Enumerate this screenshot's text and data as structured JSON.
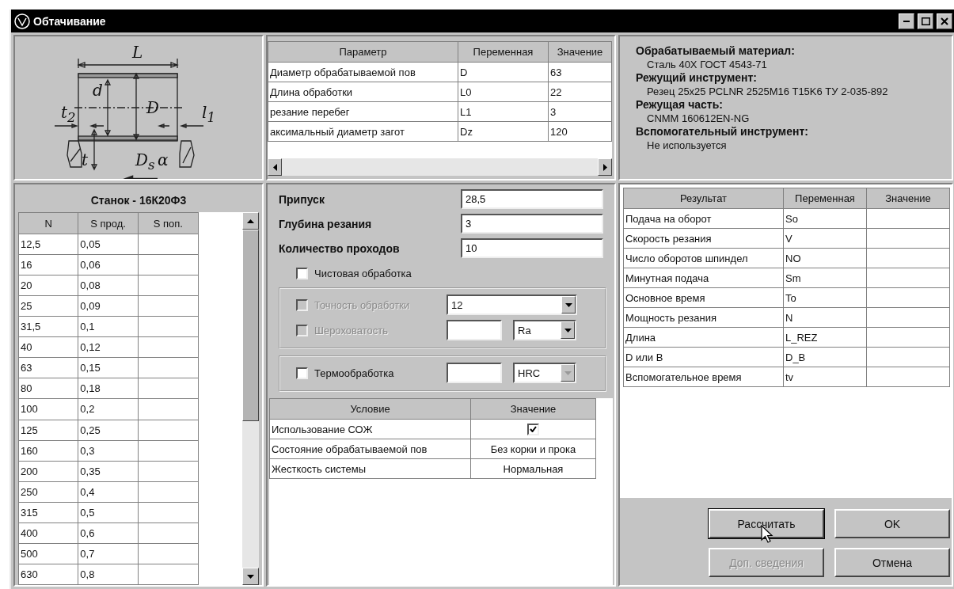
{
  "window": {
    "title": "Обтачивание"
  },
  "sketch": {
    "labels": [
      "L",
      "d",
      "D",
      "t$_{2}$",
      "l$_{1}$",
      "t",
      "D$_{s}$",
      "α"
    ]
  },
  "params_table": {
    "columns": [
      "Параметр",
      "Переменная",
      "Значение"
    ],
    "rows": [
      [
        "Диаметр обрабатываемой пов",
        "D",
        "63"
      ],
      [
        "Длина обработки",
        "L0",
        "22"
      ],
      [
        "резание перебег",
        "L1",
        "3"
      ],
      [
        "аксимальный диаметр загот",
        "Dz",
        "120"
      ]
    ]
  },
  "info": [
    {
      "kind": "heading",
      "text": "Обрабатываемый материал:"
    },
    {
      "kind": "value",
      "text": "Сталь 40Х ГОСТ 4543-71"
    },
    {
      "kind": "heading",
      "text": "Режущий инструмент:"
    },
    {
      "kind": "value",
      "text": "Резец 25x25 PCLNR 2525M16 T15K6 ТУ 2-035-892"
    },
    {
      "kind": "heading",
      "text": "Режущая часть:"
    },
    {
      "kind": "value",
      "text": "CNMM 160612EN-NG"
    },
    {
      "kind": "heading",
      "text": "Вспомогательный инструмент:"
    },
    {
      "kind": "value",
      "text": "Не используется"
    }
  ],
  "machine": {
    "title": "Станок - 16К20Ф3",
    "columns": [
      "N",
      "S прод.",
      "S поп."
    ],
    "rows": [
      [
        "12,5",
        "0,05"
      ],
      [
        "16",
        "0,06"
      ],
      [
        "20",
        "0,08"
      ],
      [
        "25",
        "0,09"
      ],
      [
        "31,5",
        "0,1"
      ],
      [
        "40",
        "0,12"
      ],
      [
        "63",
        "0,15"
      ],
      [
        "80",
        "0,18"
      ],
      [
        "100",
        "0,2"
      ],
      [
        "125",
        "0,25"
      ],
      [
        "160",
        "0,3"
      ],
      [
        "200",
        "0,35"
      ],
      [
        "250",
        "0,4"
      ],
      [
        "315",
        "0,5"
      ],
      [
        "400",
        "0,6"
      ],
      [
        "500",
        "0,7"
      ],
      [
        "630",
        "0,8"
      ]
    ]
  },
  "fields": [
    {
      "label": "Припуск",
      "value": "28,5"
    },
    {
      "label": "Глубина резания",
      "value": "3"
    },
    {
      "label": "Количество проходов",
      "value": "10"
    }
  ],
  "finishing": {
    "label": "Чистовая обработка",
    "checked": false
  },
  "option_groups": [
    {
      "rows": [
        {
          "kind": "dropdown",
          "label": "Точность обработки",
          "checked": false,
          "disabled": true,
          "dropdown": {
            "value": "12",
            "disabled": false
          }
        },
        {
          "kind": "input-dropdown",
          "label": "Шероховатость",
          "checked": false,
          "disabled": true,
          "dropdown": {
            "value": "Ra",
            "disabled": false
          }
        }
      ]
    },
    {
      "rows": [
        {
          "kind": "input-dropdown",
          "label": "Термообработка",
          "checked": false,
          "disabled": false,
          "dropdown": {
            "value": "HRC",
            "disabled": true
          }
        }
      ]
    }
  ],
  "conditions": {
    "columns": [
      "Условие",
      "Значение"
    ],
    "rows": [
      {
        "kind": "check",
        "name": "Использование СОЖ",
        "checked": true
      },
      {
        "kind": "text",
        "name": "Состояние обрабатываемой пов",
        "value": "Без корки и прока"
      },
      {
        "kind": "text",
        "name": "Жесткость системы",
        "value": "Нормальная"
      }
    ]
  },
  "results": {
    "columns": [
      "Результат",
      "Переменная",
      "Значение"
    ],
    "rows": [
      [
        "Подача на оборот",
        "So"
      ],
      [
        "Скорость резания",
        "V"
      ],
      [
        "Число оборотов шпиндел",
        "NO"
      ],
      [
        "Минутная подача",
        "Sm"
      ],
      [
        "Основное время",
        "To"
      ],
      [
        "Мощность резания",
        "N"
      ],
      [
        "Длина",
        "L_REZ"
      ],
      [
        "D или B",
        "D_B"
      ],
      [
        "Вспомогательное время",
        "tv"
      ]
    ]
  },
  "buttons": [
    {
      "label": "Рассчитать",
      "disabled": false,
      "focused": true
    },
    {
      "label": "OK",
      "disabled": false,
      "focused": false
    },
    {
      "label": "Доп. сведения",
      "disabled": true,
      "focused": false
    },
    {
      "label": "Отмена",
      "disabled": false,
      "focused": false
    }
  ]
}
